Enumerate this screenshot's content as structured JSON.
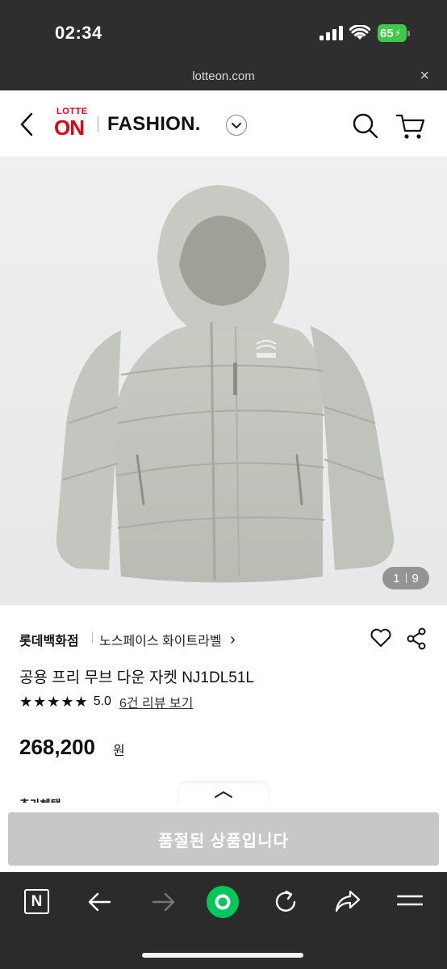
{
  "status_bar": {
    "time": "02:34",
    "battery": "65"
  },
  "url_bar": {
    "url": "lotteon.com",
    "close": "×"
  },
  "header": {
    "logo_top": "LOTTE",
    "logo_main": "ON",
    "section": "FASHION.",
    "icons": [
      "back-icon",
      "search-icon",
      "cart-icon",
      "chevron-down-icon"
    ]
  },
  "product": {
    "image_counter": {
      "current": "1",
      "total": "9"
    },
    "brand": "롯데백화점",
    "store": "노스페이스 화이트라벨",
    "store_arrow": "›",
    "title": "공용 프리 무브 다운 자켓 NJ1DL51L",
    "stars": "★★★★★",
    "rating": "5.0",
    "review_link": "6건 리뷰 보기",
    "price": "268,200",
    "currency": "원",
    "benefit_label": "추가혜택",
    "soldout_button": "품절된 상품입니다"
  },
  "browser_toolbar": {
    "icons": [
      "naver-n-icon",
      "back-arrow-icon",
      "forward-arrow-icon",
      "home-circle-icon",
      "reload-icon",
      "share-icon",
      "menu-icon"
    ]
  },
  "colors": {
    "accent_red": "#e60012",
    "naver_green": "#03c75a",
    "soldout_gray": "#c7c7c7"
  }
}
